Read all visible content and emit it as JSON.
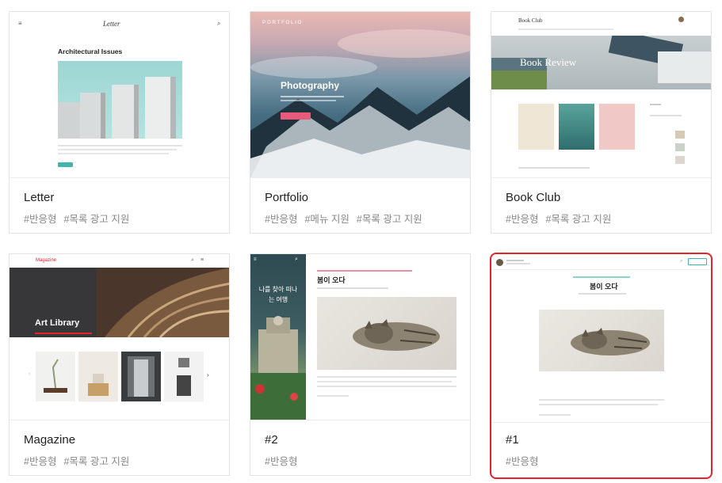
{
  "colors": {
    "selected_border": "#e5232b",
    "accent_pink": "#e85a7a",
    "accent_teal": "#3fb8a8"
  },
  "cards": [
    {
      "name": "Letter",
      "tags": [
        "#반응형",
        "#목록 광고 지원"
      ],
      "preview": {
        "brand": "Letter",
        "post_title": "Architectural Issues"
      }
    },
    {
      "name": "Portfolio",
      "tags": [
        "#반응형",
        "#메뉴 지원",
        "#목록 광고 지원"
      ],
      "preview": {
        "brand": "PORTFOLIO",
        "heading": "Photography"
      }
    },
    {
      "name": "Book Club",
      "tags": [
        "#반응형",
        "#목록 광고 지원"
      ],
      "preview": {
        "brand": "Book Club",
        "banner": "Book Review"
      }
    },
    {
      "name": "Magazine",
      "tags": [
        "#반응형",
        "#목록 광고 지원"
      ],
      "preview": {
        "brand": "Magazine",
        "banner": "Art Library"
      }
    },
    {
      "name": "#2",
      "tags": [
        "#반응형"
      ],
      "preview": {
        "side_title": "나를 찾아 떠나는 여행",
        "post_title": "봄이 오다"
      }
    },
    {
      "name": "#1",
      "tags": [
        "#반응형"
      ],
      "selected": true,
      "preview": {
        "post_title": "봄이 오다"
      }
    }
  ]
}
